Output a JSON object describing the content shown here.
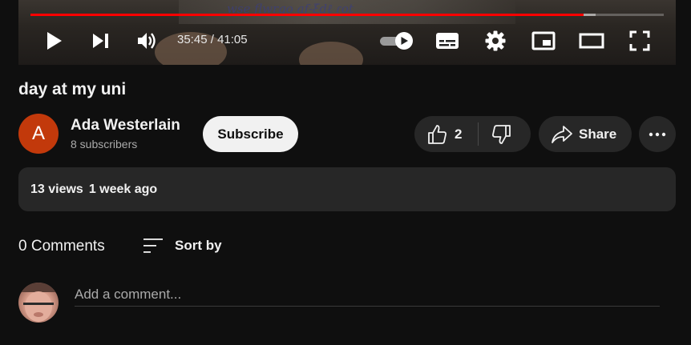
{
  "player": {
    "progress_played_fraction": 0.874,
    "progress_buffered_fraction": 0.893,
    "current_time": "35:45",
    "duration": "41:05",
    "time_separator": " / ",
    "colors": {
      "progress": "#ff0000"
    },
    "controls": [
      "play-icon",
      "next-icon",
      "volume-icon",
      "autoplay-toggle-icon",
      "captions-icon",
      "settings-icon",
      "miniplayer-icon",
      "theater-mode-icon",
      "fullscreen-icon"
    ]
  },
  "video": {
    "title": "day at my uni"
  },
  "channel": {
    "avatar_letter": "A",
    "avatar_color": "#c2390b",
    "name": "Ada Westerlain",
    "subscribers": "8 subscribers",
    "subscribe_label": "Subscribe"
  },
  "actions": {
    "like_count": "2",
    "share_label": "Share"
  },
  "description": {
    "views": "13 views",
    "date": "1 week ago"
  },
  "comments": {
    "count_label": "0 Comments",
    "sort_label": "Sort by",
    "placeholder": "Add a comment..."
  }
}
